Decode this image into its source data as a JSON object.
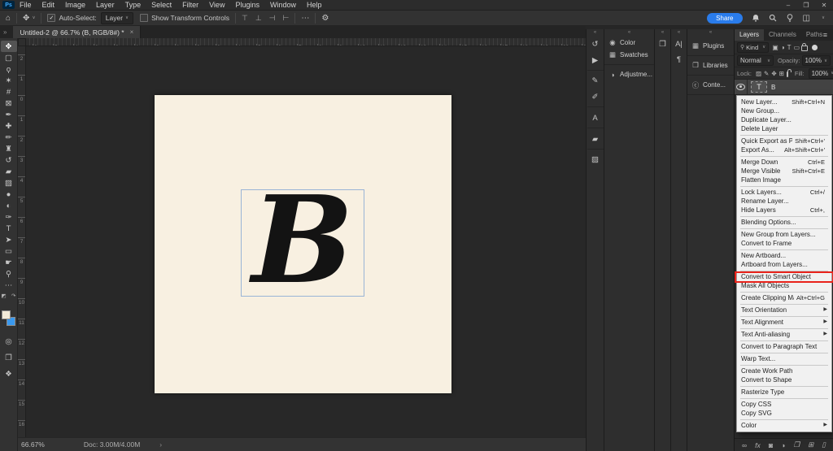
{
  "titlebar": {
    "logo": "Ps",
    "menus": [
      "File",
      "Edit",
      "Image",
      "Layer",
      "Type",
      "Select",
      "Filter",
      "View",
      "Plugins",
      "Window",
      "Help"
    ],
    "window_controls": [
      {
        "name": "minimize-button",
        "glyph": "–"
      },
      {
        "name": "restore-button",
        "glyph": "❐"
      },
      {
        "name": "close-button",
        "glyph": "✕"
      }
    ]
  },
  "options_bar": {
    "home_glyph": "⌂",
    "tool_glyph": "✥",
    "auto_select_label": "Auto-Select:",
    "target_select_value": "Layer",
    "show_transform_label": "Show Transform Controls",
    "align_icons": [
      {
        "name": "align-left-edges-icon",
        "glyph": "⊤"
      },
      {
        "name": "align-horizontal-centers-icon",
        "glyph": "⊥"
      },
      {
        "name": "align-right-edges-icon",
        "glyph": "⊣"
      },
      {
        "name": "distribute-spacing-icon",
        "glyph": "⊢"
      }
    ],
    "more_glyph": "⋯",
    "gear_glyph": "⚙",
    "share_label": "Share",
    "workspace_glyph": "◫"
  },
  "document_tab": {
    "expand_glyph": "»",
    "title": "Untitled-2 @ 66.7% (B, RGB/8#) *",
    "close_glyph": "×"
  },
  "toolbar": {
    "tools": [
      {
        "name": "move-tool",
        "glyph": "✥",
        "selected": true
      },
      {
        "name": "rectangular-marquee-tool",
        "glyph": "▢"
      },
      {
        "name": "lasso-tool",
        "glyph": "ϙ"
      },
      {
        "name": "object-selection-tool",
        "glyph": "✶"
      },
      {
        "name": "crop-tool",
        "glyph": "#"
      },
      {
        "name": "frame-tool",
        "glyph": "⊠"
      },
      {
        "name": "eyedropper-tool",
        "glyph": "✒"
      },
      {
        "name": "spot-healing-brush-tool",
        "glyph": "✚"
      },
      {
        "name": "brush-tool",
        "glyph": "✏"
      },
      {
        "name": "clone-stamp-tool",
        "glyph": "♜"
      },
      {
        "name": "history-brush-tool",
        "glyph": "↺"
      },
      {
        "name": "eraser-tool",
        "glyph": "▰"
      },
      {
        "name": "gradient-tool",
        "glyph": "▨"
      },
      {
        "name": "blur-tool",
        "glyph": "●"
      },
      {
        "name": "dodge-tool",
        "glyph": "◐"
      },
      {
        "name": "pen-tool",
        "glyph": "✑"
      },
      {
        "name": "type-tool",
        "glyph": "T"
      },
      {
        "name": "path-selection-tool",
        "glyph": "➤"
      },
      {
        "name": "rectangle-tool",
        "glyph": "▭"
      },
      {
        "name": "hand-tool",
        "glyph": "☛"
      },
      {
        "name": "zoom-tool",
        "glyph": "⚲"
      },
      {
        "name": "edit-toolbar-button",
        "glyph": "⋯"
      }
    ],
    "default_colors_glyph": "◩",
    "swap_colors_glyph": "↷",
    "foreground_color": "#f3ebd9",
    "background_color": "#3a99ee",
    "bottom_icons": [
      {
        "name": "quick-mask-button",
        "glyph": "◎"
      },
      {
        "name": "screen-mode-button",
        "glyph": "❐"
      },
      {
        "name": "capture-extension-icon",
        "glyph": "❖"
      }
    ]
  },
  "rulers": {
    "horizontal": [
      "6",
      "5",
      "4",
      "3",
      "2",
      "1",
      "0",
      "1",
      "2",
      "3",
      "4",
      "5",
      "6",
      "7",
      "8",
      "9",
      "10",
      "11",
      "12",
      "13",
      "14",
      "15",
      "16",
      "17",
      "18",
      "19",
      "20",
      "21"
    ],
    "vertical": [
      "2",
      "1",
      "0",
      "1",
      "2",
      "3",
      "4",
      "5",
      "6",
      "7",
      "8",
      "9",
      "10",
      "11",
      "12",
      "13",
      "14",
      "15",
      "16"
    ]
  },
  "canvas": {
    "letter": "B",
    "background": "#f8f0e1",
    "selection_border": "#9ab4d6"
  },
  "right_dock": {
    "collapse_glyph": "«",
    "strip1": [
      {
        "name": "history-panel-icon",
        "glyph": "↺",
        "group_end": false
      },
      {
        "name": "actions-panel-icon",
        "glyph": "▶",
        "group_end": true
      },
      {
        "name": "brush-settings-panel-icon",
        "glyph": "✎"
      },
      {
        "name": "brushes-panel-icon",
        "glyph": "✐",
        "group_end": true
      },
      {
        "name": "paragraph-styles-panel-icon",
        "glyph": "A",
        "group_end": true
      },
      {
        "name": "patterns-panel-icon",
        "glyph": "▰",
        "group_end": true
      },
      {
        "name": "gradients-panel-icon",
        "glyph": "▨"
      }
    ],
    "color_group": [
      {
        "name": "color-panel-item",
        "glyph": "◉",
        "label": "Color"
      },
      {
        "name": "swatches-panel-item",
        "glyph": "▦",
        "label": "Swatches"
      }
    ],
    "adjustments_group": [
      {
        "name": "adjustments-panel-item",
        "glyph": "◑",
        "label": "Adjustme..."
      }
    ],
    "strip2": [
      {
        "name": "libraries-folder-icon",
        "glyph": "❒"
      }
    ],
    "strip3": [
      {
        "name": "character-panel-icon",
        "glyph": "A|"
      },
      {
        "name": "paragraph-panel-icon",
        "glyph": "¶"
      }
    ],
    "plugins_group": [
      {
        "name": "plugins-panel-item",
        "glyph": "▦",
        "label": "Plugins"
      },
      {
        "name": "libraries-panel-item",
        "glyph": "❐",
        "label": "Libraries"
      },
      {
        "name": "content-credentials-panel-item",
        "glyph": "ⓒ",
        "label": "Conte..."
      }
    ]
  },
  "layers_panel": {
    "tabs": [
      {
        "name": "tab-layers",
        "label": "Layers",
        "active": true
      },
      {
        "name": "tab-channels",
        "label": "Channels",
        "active": false
      },
      {
        "name": "tab-paths",
        "label": "Paths",
        "active": false
      }
    ],
    "panel_menu_glyph": "≡",
    "search_glyph": "⚲",
    "kind_label": "Kind",
    "filter_icons": [
      {
        "name": "filter-pixel-layers-icon",
        "glyph": "▣"
      },
      {
        "name": "filter-adjustment-layers-icon",
        "glyph": "◑"
      },
      {
        "name": "filter-type-layers-icon",
        "glyph": "T"
      },
      {
        "name": "filter-shape-layers-icon",
        "glyph": "▭"
      }
    ],
    "blend_mode": "Normal",
    "opacity_label": "Opacity:",
    "opacity_value": "100%",
    "lock_label": "Lock:",
    "lock_icons": [
      {
        "name": "lock-transparent-pixels-icon",
        "glyph": "▨"
      },
      {
        "name": "lock-image-pixels-icon",
        "glyph": "✎"
      },
      {
        "name": "lock-position-icon",
        "glyph": "✥"
      },
      {
        "name": "lock-artboards-icon",
        "glyph": "⊞"
      }
    ],
    "fill_label": "Fill:",
    "fill_value": "100%",
    "layer": {
      "thumb": "T",
      "name": "B"
    },
    "bottom_icons": [
      {
        "name": "link-layers-icon",
        "glyph": "∞"
      },
      {
        "name": "layer-effects-icon",
        "glyph": "fx"
      },
      {
        "name": "add-layer-mask-icon",
        "glyph": "◙"
      },
      {
        "name": "new-adjustment-layer-icon",
        "glyph": "◑"
      },
      {
        "name": "new-group-icon",
        "glyph": "❒"
      },
      {
        "name": "new-layer-icon",
        "glyph": "⊞"
      },
      {
        "name": "delete-layer-icon",
        "glyph": "▯"
      }
    ]
  },
  "context_menu": {
    "highlight_color": "#e8231b",
    "items": [
      {
        "name": "menu-item-new-layer",
        "label": "New Layer...",
        "shortcut": "Shift+Ctrl+N"
      },
      {
        "name": "menu-item-new-group",
        "label": "New Group..."
      },
      {
        "name": "menu-item-duplicate-layer",
        "label": "Duplicate Layer..."
      },
      {
        "name": "menu-item-delete-layer",
        "label": "Delete Layer"
      },
      {
        "name": "menu-separator",
        "sep": true,
        "interactable": false
      },
      {
        "name": "menu-item-quick-export-as-png",
        "label": "Quick Export as PNG",
        "shortcut": "Shift+Ctrl+'"
      },
      {
        "name": "menu-item-export-as",
        "label": "Export As...",
        "shortcut": "Alt+Shift+Ctrl+'"
      },
      {
        "name": "menu-separator",
        "sep": true,
        "interactable": false
      },
      {
        "name": "menu-item-merge-down",
        "label": "Merge Down",
        "shortcut": "Ctrl+E"
      },
      {
        "name": "menu-item-merge-visible",
        "label": "Merge Visible",
        "shortcut": "Shift+Ctrl+E"
      },
      {
        "name": "menu-item-flatten-image",
        "label": "Flatten Image"
      },
      {
        "name": "menu-separator",
        "sep": true,
        "interactable": false
      },
      {
        "name": "menu-item-lock-layers",
        "label": "Lock Layers...",
        "shortcut": "Ctrl+/"
      },
      {
        "name": "menu-item-rename-layer",
        "label": "Rename Layer..."
      },
      {
        "name": "menu-item-hide-layers",
        "label": "Hide Layers",
        "shortcut": "Ctrl+,"
      },
      {
        "name": "menu-separator",
        "sep": true,
        "interactable": false
      },
      {
        "name": "menu-item-blending-options",
        "label": "Blending Options..."
      },
      {
        "name": "menu-separator",
        "sep": true,
        "interactable": false
      },
      {
        "name": "menu-item-new-group-from-layers",
        "label": "New Group from Layers..."
      },
      {
        "name": "menu-item-convert-to-frame",
        "label": "Convert to Frame"
      },
      {
        "name": "menu-separator",
        "sep": true,
        "interactable": false
      },
      {
        "name": "menu-item-new-artboard",
        "label": "New Artboard..."
      },
      {
        "name": "menu-item-artboard-from-layers",
        "label": "Artboard from Layers..."
      },
      {
        "name": "menu-separator",
        "sep": true,
        "interactable": false
      },
      {
        "name": "menu-item-convert-to-smart-object",
        "label": "Convert to Smart Object",
        "highlighted": true
      },
      {
        "name": "menu-item-mask-all-objects",
        "label": "Mask All Objects"
      },
      {
        "name": "menu-separator",
        "sep": true,
        "interactable": false
      },
      {
        "name": "menu-item-create-clipping-mask",
        "label": "Create Clipping Mask",
        "shortcut": "Alt+Ctrl+G"
      },
      {
        "name": "menu-separator",
        "sep": true,
        "interactable": false
      },
      {
        "name": "menu-item-text-orientation",
        "label": "Text Orientation",
        "arrow": "▶"
      },
      {
        "name": "menu-separator",
        "sep": true,
        "interactable": false
      },
      {
        "name": "menu-item-text-alignment",
        "label": "Text Alignment",
        "arrow": "▶"
      },
      {
        "name": "menu-separator",
        "sep": true,
        "interactable": false
      },
      {
        "name": "menu-item-text-anti-aliasing",
        "label": "Text Anti-aliasing",
        "arrow": "▶"
      },
      {
        "name": "menu-separator",
        "sep": true,
        "interactable": false
      },
      {
        "name": "menu-item-convert-to-paragraph-text",
        "label": "Convert to Paragraph Text"
      },
      {
        "name": "menu-separator",
        "sep": true,
        "interactable": false
      },
      {
        "name": "menu-item-warp-text",
        "label": "Warp Text..."
      },
      {
        "name": "menu-separator",
        "sep": true,
        "interactable": false
      },
      {
        "name": "menu-item-create-work-path",
        "label": "Create Work Path"
      },
      {
        "name": "menu-item-convert-to-shape",
        "label": "Convert to Shape"
      },
      {
        "name": "menu-separator",
        "sep": true,
        "interactable": false
      },
      {
        "name": "menu-item-rasterize-type",
        "label": "Rasterize Type"
      },
      {
        "name": "menu-separator",
        "sep": true,
        "interactable": false
      },
      {
        "name": "menu-item-copy-css",
        "label": "Copy CSS"
      },
      {
        "name": "menu-item-copy-svg",
        "label": "Copy SVG"
      },
      {
        "name": "menu-separator",
        "sep": true,
        "interactable": false
      },
      {
        "name": "menu-item-color",
        "label": "Color",
        "arrow": "▶"
      }
    ]
  },
  "status_bar": {
    "zoom_level": "66.67%",
    "doc_info": "Doc: 3.00M/4.00M",
    "chevron": "›"
  }
}
